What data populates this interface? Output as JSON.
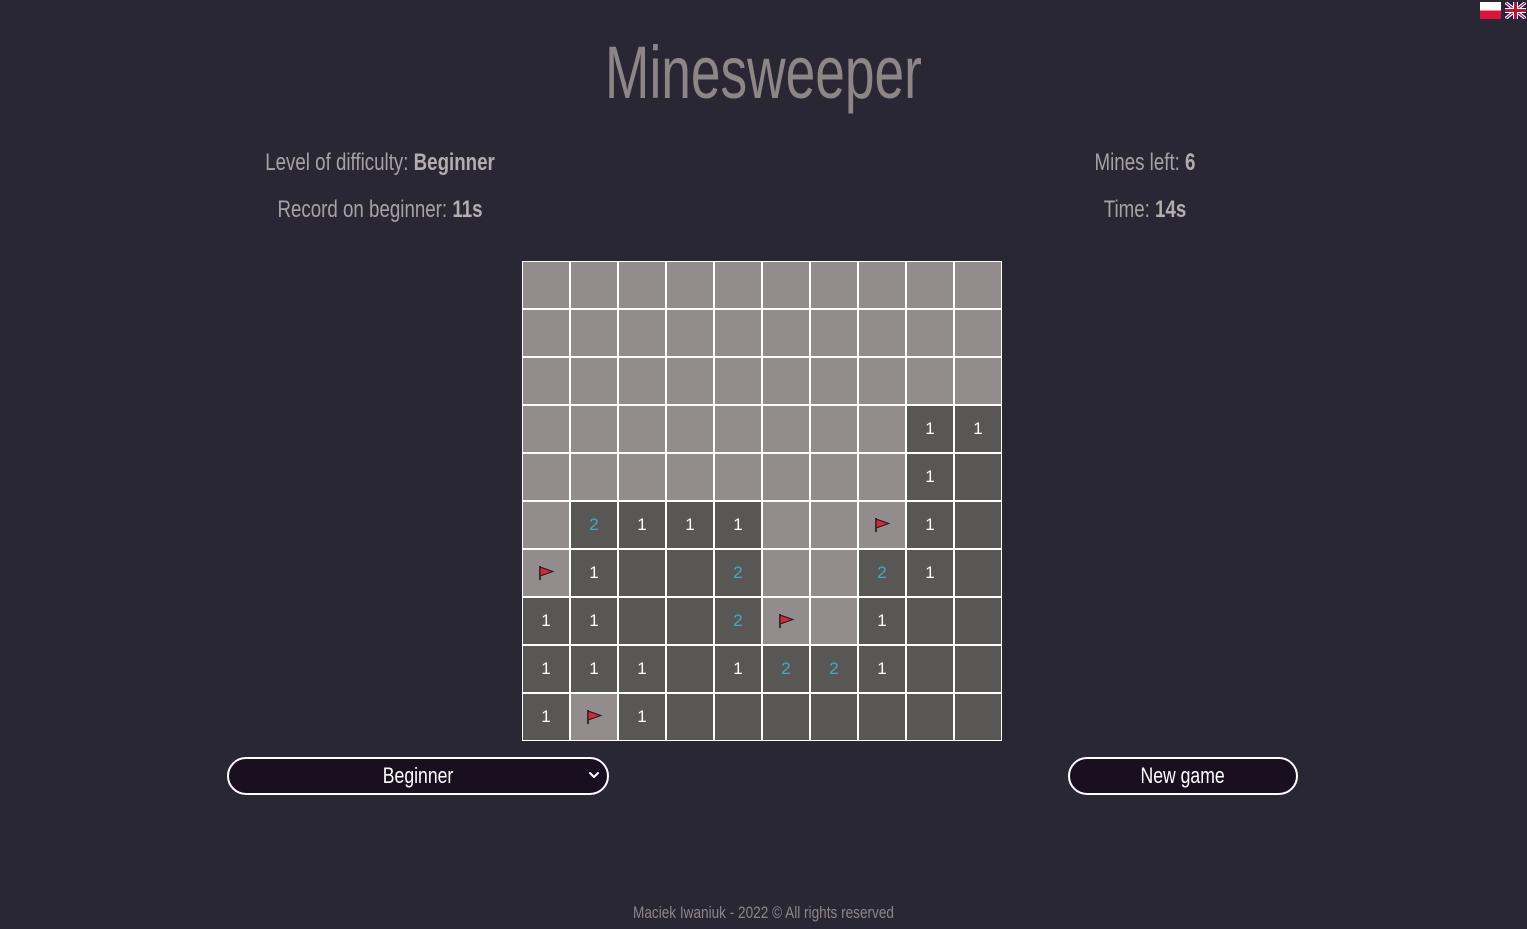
{
  "header": {
    "title": "Minesweeper"
  },
  "languages": [
    {
      "code": "pl",
      "icon": "poland-flag-icon"
    },
    {
      "code": "en",
      "icon": "uk-flag-icon"
    }
  ],
  "info": {
    "difficulty_label": "Level of difficulty:",
    "difficulty_value": "Beginner",
    "record_label": "Record on beginner:",
    "record_value": "11s",
    "mines_label": "Mines left:",
    "mines_value": "6",
    "time_label": "Time:",
    "time_value": "14s"
  },
  "board": {
    "rows": 10,
    "cols": 10,
    "grid": [
      [
        "H",
        "H",
        "H",
        "H",
        "H",
        "H",
        "H",
        "H",
        "H",
        "H"
      ],
      [
        "H",
        "H",
        "H",
        "H",
        "H",
        "H",
        "H",
        "H",
        "H",
        "H"
      ],
      [
        "H",
        "H",
        "H",
        "H",
        "H",
        "H",
        "H",
        "H",
        "H",
        "H"
      ],
      [
        "H",
        "H",
        "H",
        "H",
        "H",
        "H",
        "H",
        "H",
        "1",
        "1"
      ],
      [
        "H",
        "H",
        "H",
        "H",
        "H",
        "H",
        "H",
        "H",
        "1",
        "0"
      ],
      [
        "H",
        "2",
        "1",
        "1",
        "1",
        "H",
        "H",
        "F",
        "1",
        "0"
      ],
      [
        "F",
        "1",
        "0",
        "0",
        "2",
        "H",
        "H",
        "2",
        "1",
        "0"
      ],
      [
        "1",
        "1",
        "0",
        "0",
        "2",
        "F",
        "H",
        "1",
        "0",
        "0"
      ],
      [
        "1",
        "1",
        "1",
        "0",
        "1",
        "2",
        "2",
        "1",
        "0",
        "0"
      ],
      [
        "1",
        "F",
        "1",
        "0",
        "0",
        "0",
        "0",
        "0",
        "0",
        "0"
      ]
    ],
    "legend": {
      "H": "hidden",
      "F": "flag",
      "0": "empty",
      "1": "one",
      "2": "two"
    },
    "colors": {
      "hidden": "#928c8c",
      "revealed": "#595755",
      "number_1": "#ffffff",
      "number_2": "#3fa7c8",
      "flag": "#d8263a"
    }
  },
  "controls": {
    "difficulty_select_value": "Beginner",
    "new_game_label": "New game"
  },
  "footer": {
    "text": "Maciek Iwaniuk - 2022 © All rights reserved"
  }
}
